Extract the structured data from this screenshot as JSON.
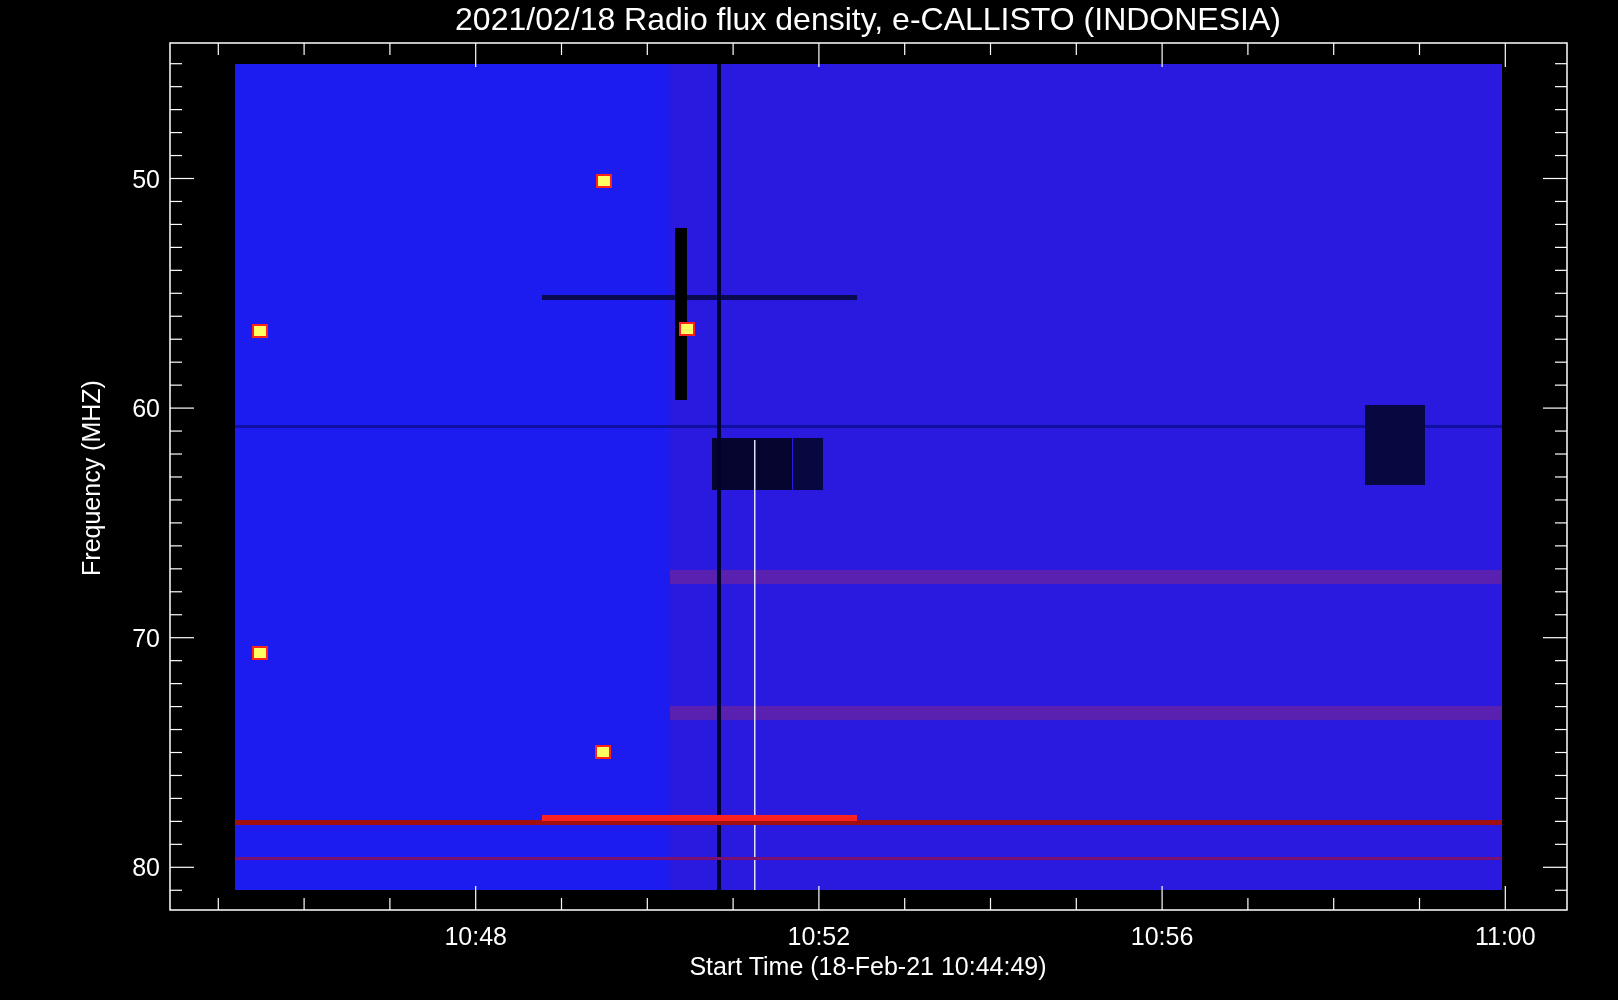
{
  "title": "2021/02/18  Radio flux density, e-CALLISTO (INDONESIA)",
  "plot": {
    "ylabel": "Frequency (MHZ)",
    "xlabel": "Start Time (18-Feb-21 10:44:49)",
    "yticks": [
      "50",
      "60",
      "70",
      "80"
    ],
    "xticks": [
      "10:48",
      "10:52",
      "10:56",
      "11:00"
    ]
  }
}
